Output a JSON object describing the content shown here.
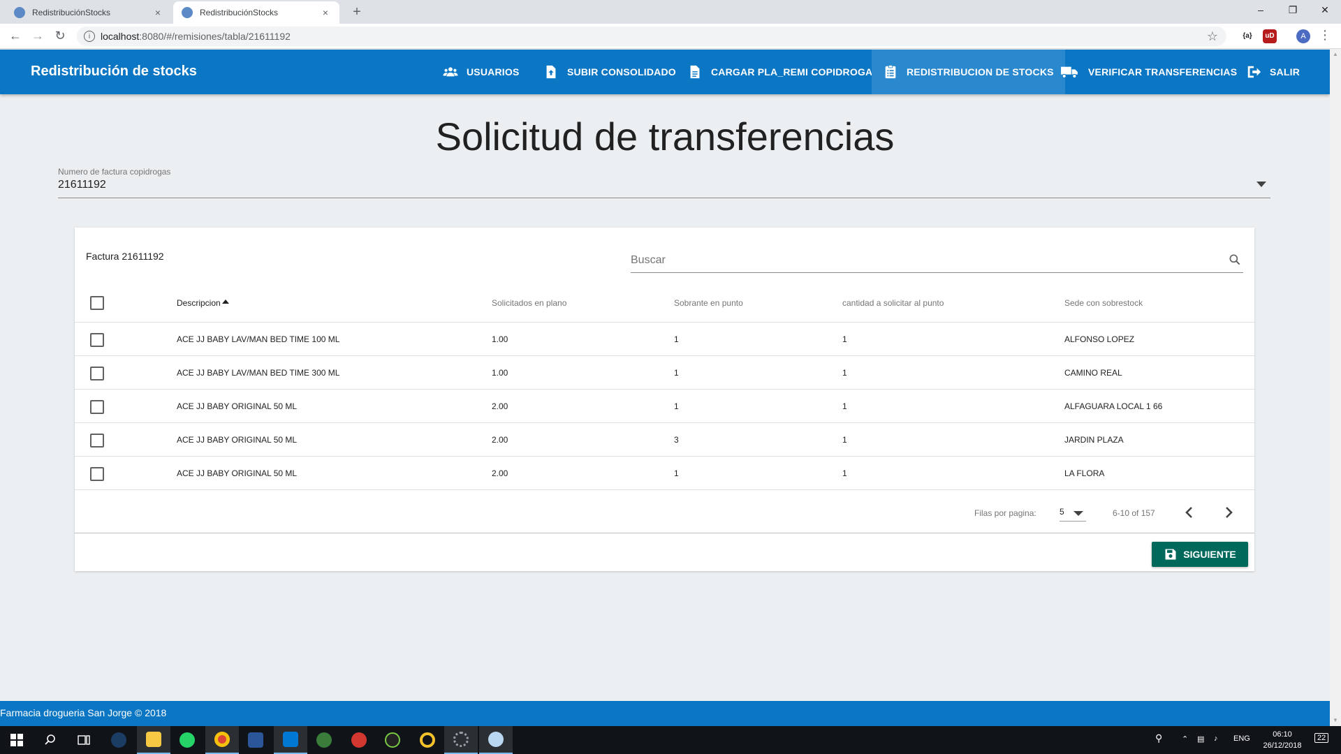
{
  "browser": {
    "tabs": [
      {
        "title": "RedistribuciónStocks",
        "active": false
      },
      {
        "title": "RedistribuciónStocks",
        "active": true
      }
    ],
    "new_tab_glyph": "+",
    "close_glyph": "×",
    "url_host": "localhost",
    "url_path": ":8080/#/remisiones/tabla/21611192",
    "profile_initial": "A",
    "extension_1": "{a}",
    "extension_2": "uD"
  },
  "appbar": {
    "brand": "Redistribución de stocks",
    "nav": [
      {
        "label": "USUARIOS",
        "icon": "users-icon"
      },
      {
        "label": "SUBIR CONSOLIDADO",
        "icon": "file-upload-icon"
      },
      {
        "label": "CARGAR PLA_REMI COPIDROGAS",
        "icon": "file-document-icon"
      },
      {
        "label": "REDISTRIBUCION DE STOCKS",
        "icon": "clipboard-list-icon",
        "active": true
      },
      {
        "label": "VERIFICAR TRANSFERENCIAS",
        "icon": "truck-icon"
      },
      {
        "label": "SALIR",
        "icon": "logout-icon"
      }
    ]
  },
  "page": {
    "title": "Solicitud de transferencias",
    "invoice_select": {
      "label": "Numero de factura copidrogas",
      "value": "21611192"
    }
  },
  "table": {
    "title": "Factura 21611192",
    "search_placeholder": "Buscar",
    "columns": [
      "Descripcion",
      "Solicitados en plano",
      "Sobrante en punto",
      "cantidad a solicitar al punto",
      "Sede con sobrestock"
    ],
    "rows": [
      {
        "descripcion": "ACE JJ BABY LAV/MAN BED TIME 100 ML",
        "solicitados": "1.00",
        "sobrante": "1",
        "cantidad": "1",
        "sede": "ALFONSO LOPEZ"
      },
      {
        "descripcion": "ACE JJ BABY LAV/MAN BED TIME 300 ML",
        "solicitados": "1.00",
        "sobrante": "1",
        "cantidad": "1",
        "sede": "CAMINO REAL"
      },
      {
        "descripcion": "ACE JJ BABY ORIGINAL 50 ML",
        "solicitados": "2.00",
        "sobrante": "1",
        "cantidad": "1",
        "sede": "ALFAGUARA LOCAL 1 66"
      },
      {
        "descripcion": "ACE JJ BABY ORIGINAL 50 ML",
        "solicitados": "2.00",
        "sobrante": "3",
        "cantidad": "1",
        "sede": "JARDIN PLAZA"
      },
      {
        "descripcion": "ACE JJ BABY ORIGINAL 50 ML",
        "solicitados": "2.00",
        "sobrante": "1",
        "cantidad": "1",
        "sede": "LA FLORA"
      }
    ],
    "pagination": {
      "rows_per_page_label": "Filas por pagina:",
      "rows_per_page": "5",
      "range": "6-10 of 157"
    },
    "next_button": "SIGUIENTE"
  },
  "footer": {
    "text": "Farmacia drogueria San Jorge © 2018"
  },
  "taskbar": {
    "language": "ENG",
    "time": "06:10",
    "date": "26/12/2018",
    "notifications": "22"
  },
  "colors": {
    "appbar": "#0b76c4",
    "appbar_active": "#2a88cf",
    "next_button": "#00695c",
    "page_background": "#eceff1"
  }
}
